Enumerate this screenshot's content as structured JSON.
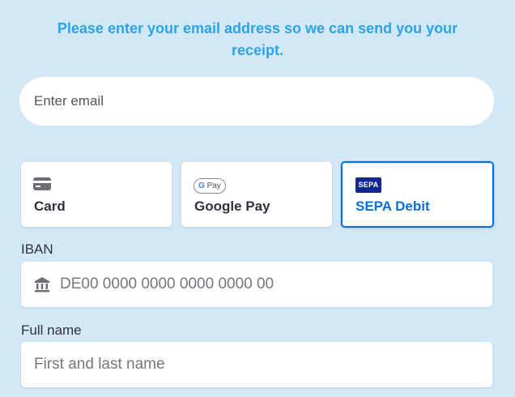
{
  "prompt": {
    "text": "Please enter your email address so we can send you your receipt."
  },
  "email": {
    "placeholder": "Enter email",
    "value": ""
  },
  "payment_methods": [
    {
      "label": "Card",
      "icon": "card-icon",
      "selected": false
    },
    {
      "label": "Google Pay",
      "icon": "google-pay-icon",
      "icon_text": "Pay",
      "icon_g": "G",
      "selected": false
    },
    {
      "label": "SEPA Debit",
      "icon": "sepa-icon",
      "icon_text": "SEPA",
      "selected": true
    }
  ],
  "iban": {
    "label": "IBAN",
    "placeholder": "DE00 0000 0000 0000 0000 00",
    "value": "",
    "icon": "bank-icon"
  },
  "full_name": {
    "label": "Full name",
    "placeholder": "First and last name",
    "value": ""
  },
  "colors": {
    "background": "#d3e8f7",
    "prompt_text": "#2ea3e2",
    "selected_accent": "#0570de",
    "sepa_blue": "#10298e"
  }
}
